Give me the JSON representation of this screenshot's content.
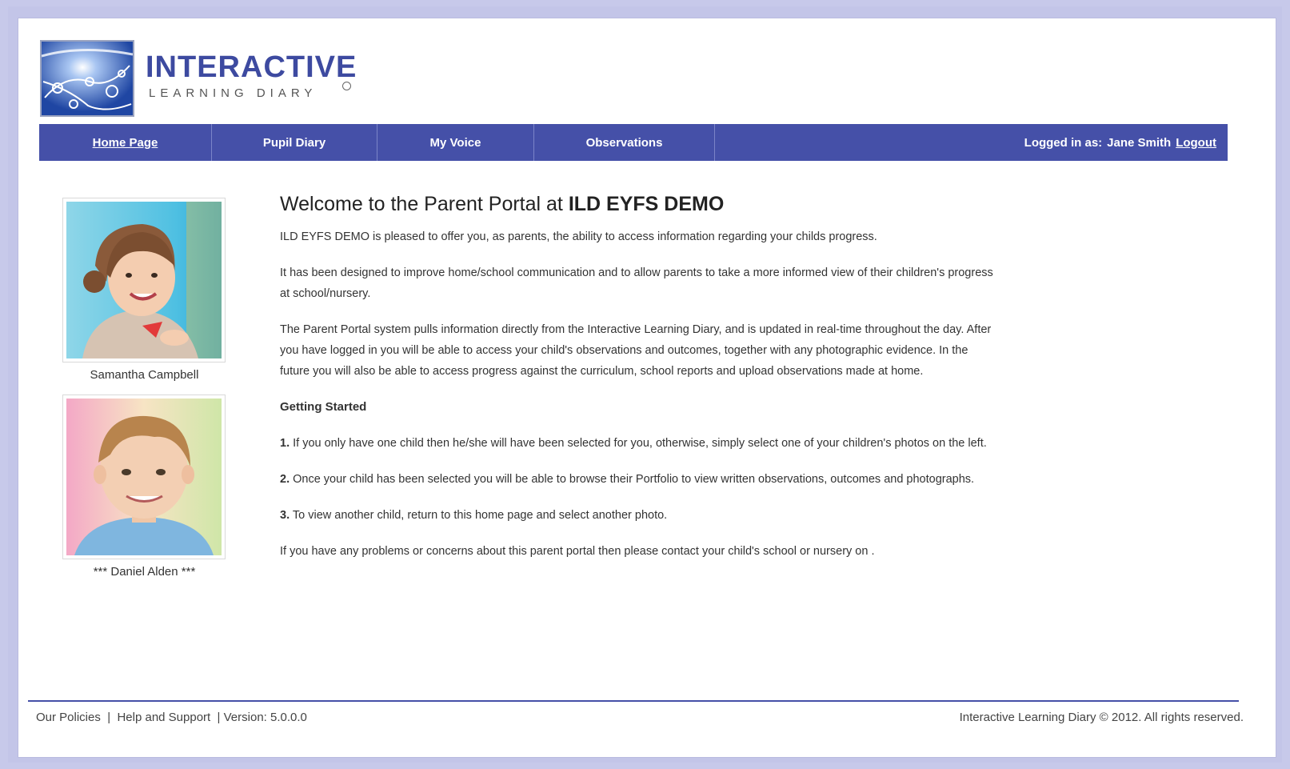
{
  "logo": {
    "title": "INTERACTIVE",
    "subtitle": "LEARNING DIARY"
  },
  "nav": {
    "items": [
      {
        "label": "Home Page",
        "active": true
      },
      {
        "label": "Pupil Diary",
        "active": false
      },
      {
        "label": "My Voice",
        "active": false
      },
      {
        "label": "Observations",
        "active": false
      }
    ],
    "logged_in_label": "Logged in as:",
    "user_name": "Jane Smith",
    "logout_label": "Logout"
  },
  "children": [
    {
      "name": "Samantha Campbell"
    },
    {
      "name": "*** Daniel Alden ***"
    }
  ],
  "main": {
    "title_prefix": "Welcome to the Parent Portal at",
    "school_name": "ILD EYFS DEMO",
    "paragraphs": [
      "ILD EYFS DEMO is pleased to offer you, as parents, the ability to access information regarding your childs progress.",
      "It has been designed to improve home/school communication and to allow parents to take a more informed view of their children's progress at school/nursery.",
      "The Parent Portal system pulls information directly from the Interactive Learning Diary, and is updated in real-time throughout the day. After you have logged in you will be able to access your child's observations and outcomes, together with any photographic evidence. In the future you will also be able to access progress against the curriculum, school reports and upload observations made at home."
    ],
    "getting_started_heading": "Getting Started",
    "steps": [
      {
        "num": "1.",
        "text": "If you only have one child then he/she will have been selected for you, otherwise, simply select one of your children's photos on the left."
      },
      {
        "num": "2.",
        "text": "Once your child has been selected you will be able to browse their Portfolio to view written observations, outcomes and photographs."
      },
      {
        "num": "3.",
        "text": "To view another child, return to this home page and select another photo."
      }
    ],
    "contact_text": "If you have any problems or concerns about this parent portal then please contact your child's school or nursery on ."
  },
  "footer": {
    "policies": "Our Policies",
    "help": "Help and Support",
    "version": "Version: 5.0.0.0",
    "sep": "|",
    "copyright": "Interactive Learning Diary © 2012. All rights reserved."
  }
}
